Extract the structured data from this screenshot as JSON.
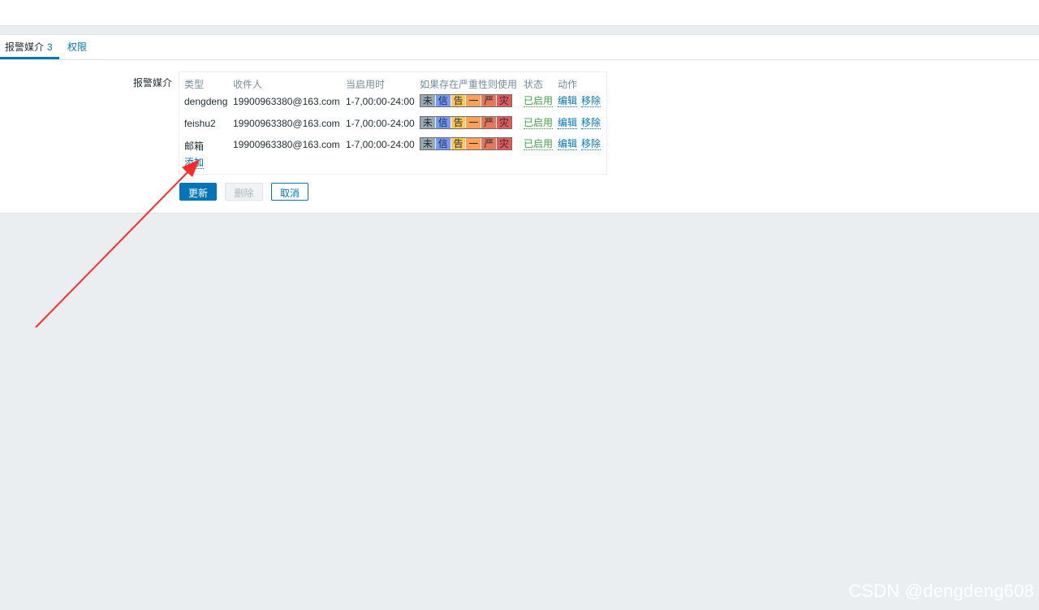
{
  "tabs": [
    {
      "label": "报警媒介",
      "count": "3"
    },
    {
      "label": "权限"
    }
  ],
  "form": {
    "field_label": "报警媒介",
    "columns": [
      "类型",
      "收件人",
      "当启用时",
      "如果存在严重性则使用",
      "状态",
      "动作"
    ],
    "rows": [
      {
        "type": "dengdeng",
        "recipient": "19900963380@163.com",
        "when": "1-7,00:00-24:00",
        "status": "已启用",
        "edit": "编辑",
        "remove": "移除"
      },
      {
        "type": "feishu2",
        "recipient": "19900963380@163.com",
        "when": "1-7,00:00-24:00",
        "status": "已启用",
        "edit": "编辑",
        "remove": "移除"
      },
      {
        "type": "邮箱",
        "recipient": "19900963380@163.com",
        "when": "1-7,00:00-24:00",
        "status": "已启用",
        "edit": "编辑",
        "remove": "移除"
      }
    ],
    "severity_labels": [
      "未",
      "信",
      "告",
      "一",
      "严",
      "灾"
    ],
    "severity_colors": [
      "#97AAB3",
      "#7499FF",
      "#FFC859",
      "#FFA059",
      "#E97659",
      "#E45959"
    ],
    "add_label": "添加"
  },
  "buttons": {
    "update": "更新",
    "delete": "删除",
    "cancel": "取消"
  },
  "watermark": "CSDN @dengdeng608",
  "colors": {
    "accent": "#0275b8",
    "enabled": "#429e47",
    "annotation_arrow": "#ff2a2a"
  }
}
